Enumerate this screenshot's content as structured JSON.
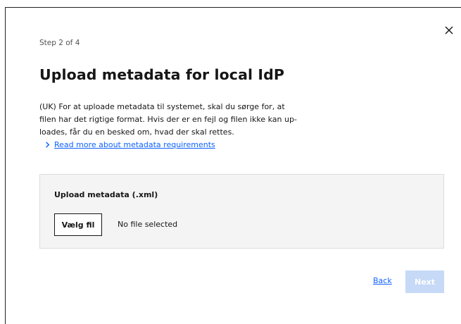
{
  "dialog": {
    "step_label": "Step 2 of 4",
    "title": "Upload metadata for local IdP",
    "description": "(UK) For at uploade metadata til systemet, skal du sørge for, at filen har det rigtige format. Hvis der er en fejl og filen ikke kan up-loades, får du en besked om, hvad der skal rettes.",
    "read_more_link": "Read more about metadata requirements",
    "upload": {
      "label": "Upload metadata (.xml)",
      "choose_file_button": "Vælg fil",
      "file_status": "No file selected"
    },
    "footer": {
      "back_label": "Back",
      "next_label": "Next",
      "next_disabled": true
    }
  },
  "icons": {
    "close": "close-icon",
    "read_more": "chevron-right-icon"
  },
  "colors": {
    "link": "#0f62fe",
    "next_disabled_bg": "#c6d9f7",
    "panel_bg": "#f4f4f4"
  }
}
